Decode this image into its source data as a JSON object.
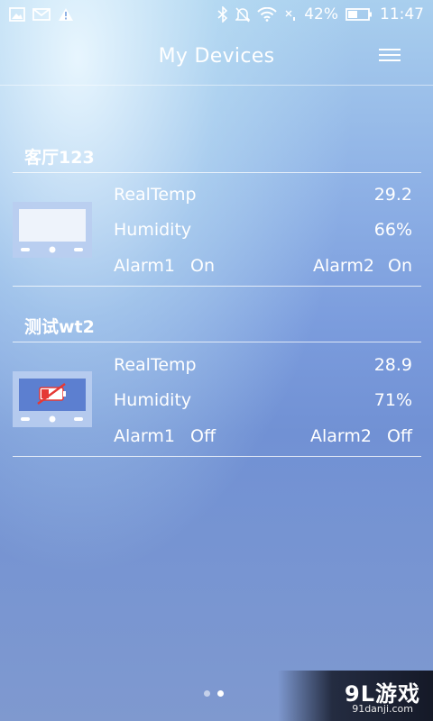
{
  "status_bar": {
    "battery_percent": "42%",
    "time": "11:47",
    "icons_left": [
      "image-icon",
      "mail-icon",
      "warning-icon"
    ],
    "icons_right": [
      "bluetooth-icon",
      "mute-icon",
      "wifi-icon",
      "no-signal-icon",
      "battery-icon"
    ]
  },
  "header": {
    "title": "My Devices"
  },
  "devices": [
    {
      "name": "客厅123",
      "icon": "device-screen-icon",
      "realtemp_label": "RealTemp",
      "realtemp_value": "29.2",
      "humidity_label": "Humidity",
      "humidity_value": "66%",
      "alarm1_label": "Alarm1",
      "alarm1_value": "On",
      "alarm2_label": "Alarm2",
      "alarm2_value": "On"
    },
    {
      "name": "测试wt2",
      "icon": "device-low-battery-icon",
      "realtemp_label": "RealTemp",
      "realtemp_value": "28.9",
      "humidity_label": "Humidity",
      "humidity_value": "71%",
      "alarm1_label": "Alarm1",
      "alarm1_value": "Off",
      "alarm2_label": "Alarm2",
      "alarm2_value": "Off"
    }
  ],
  "pager": {
    "pages": 2,
    "active_page": 2
  },
  "watermark": {
    "brand": "9L游戏",
    "url": "91danji.com"
  },
  "colors": {
    "text": "#ffffff",
    "alert_red": "#e53935"
  }
}
